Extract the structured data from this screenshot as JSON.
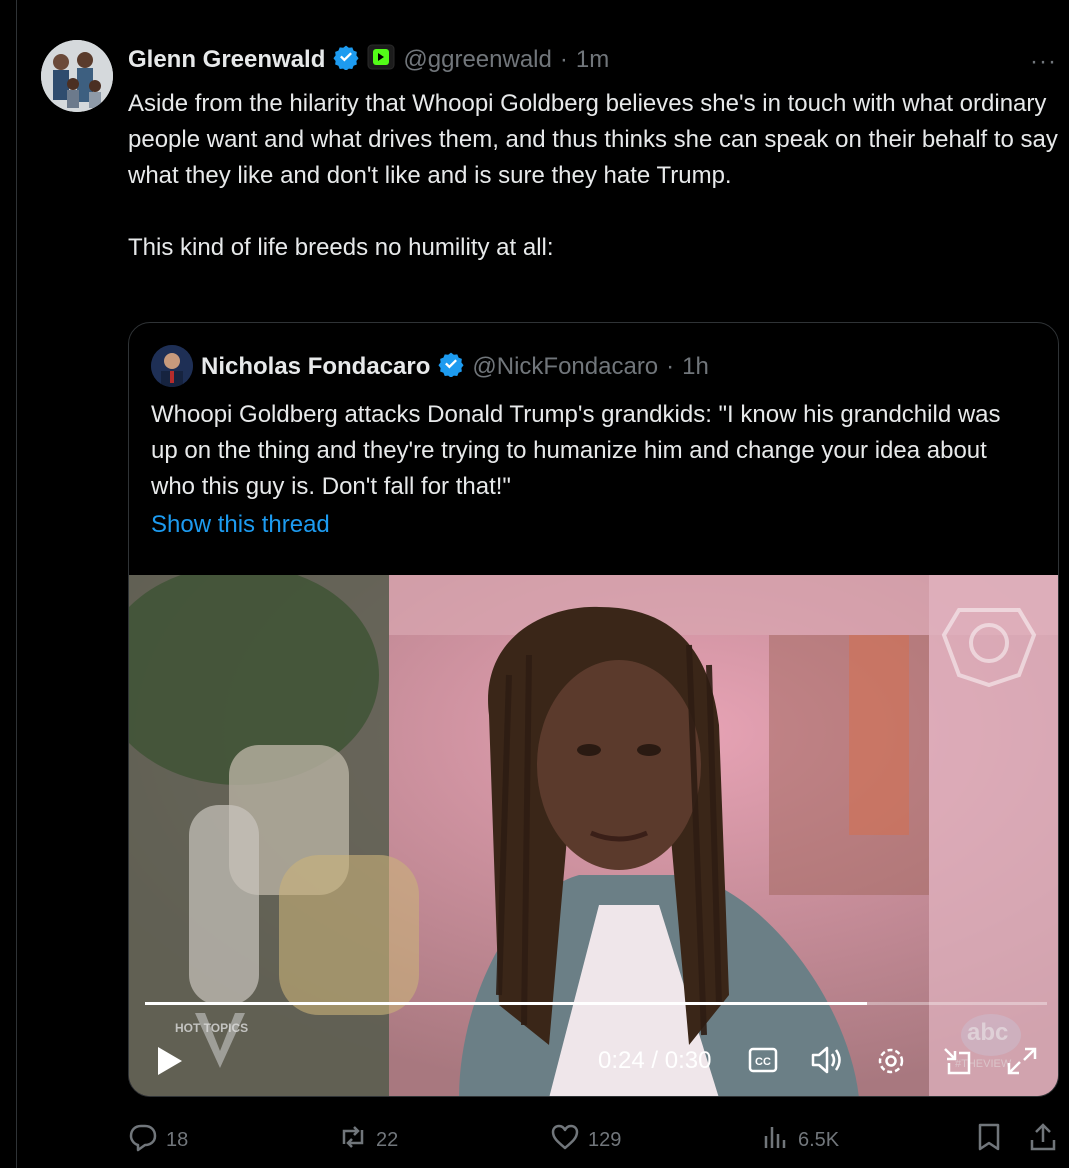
{
  "tweet": {
    "author": {
      "name": "Glenn Greenwald",
      "handle": "@ggreenwald",
      "time": "1m"
    },
    "text": "Aside from the hilarity that Whoopi Goldberg believes she's in touch with what ordinary people want and what drives them, and thus thinks she can speak on their behalf to say what they like and don't like and is sure they hate Trump.\n\nThis kind of life breeds no humility at all:",
    "more_label": "···"
  },
  "quote": {
    "author": {
      "name": "Nicholas Fondacaro",
      "handle": "@NickFondacaro",
      "time": "1h"
    },
    "text": "Whoopi Goldberg attacks Donald Trump's grandkids: \"I know his grandchild was up on the thing and they're trying to humanize him and change your idea about who this guy is. Don't fall for that!\"",
    "show_thread": "Show this thread"
  },
  "video": {
    "progress": 0.8,
    "time": "0:24 / 0:30",
    "overlay_topics": "HOT TOPICS",
    "overlay_network": "abc",
    "overlay_hashtag": "#THEVIEW",
    "cc_label": "CC"
  },
  "actions": {
    "replies": "18",
    "reposts": "22",
    "likes": "129",
    "views": "6.5K"
  },
  "colors": {
    "accent": "#1d9bf0",
    "verified": "#1d9bf0",
    "muted": "#71767b"
  }
}
